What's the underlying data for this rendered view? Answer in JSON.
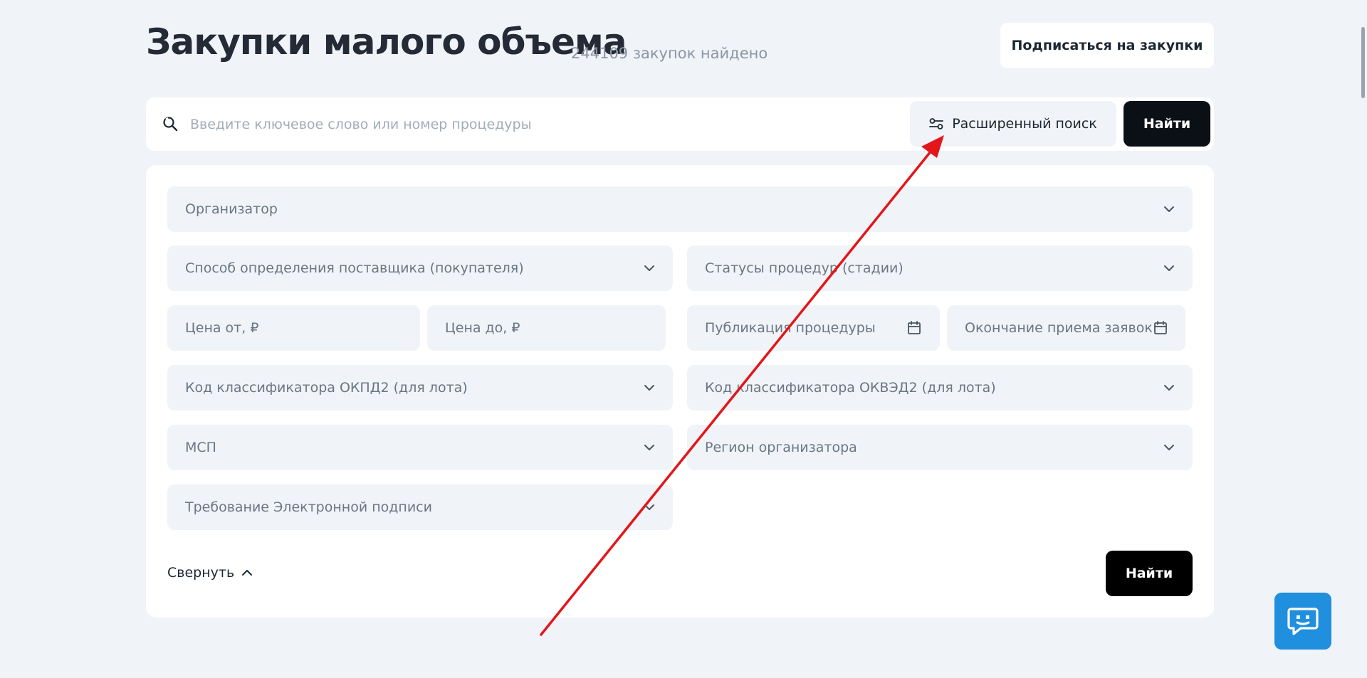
{
  "header": {
    "title": "Закупки малого объема",
    "count": "244109 закупок найдено",
    "subscribe_label": "Подписаться на закупки"
  },
  "search": {
    "placeholder": "Введите ключевое слово или номер процедуры",
    "advanced_label": "Расширенный поиск",
    "find_label": "Найти"
  },
  "filters": {
    "organizer": "Организатор",
    "supplier_method": "Способ определения поставщика (покупателя)",
    "procedure_status": "Статусы процедур (стадии)",
    "price_from": "Цена от, ₽",
    "price_to": "Цена до, ₽",
    "publication": "Публикация процедуры",
    "deadline": "Окончание приема заявок",
    "okpd2": "Код классификатора ОКПД2 (для лота)",
    "okved2": "Код классификатора ОКВЭД2 (для лота)",
    "msp": "МСП",
    "region": "Регион организатора",
    "signature": "Требование Электронной подписи",
    "collapse_label": "Свернуть",
    "find_label": "Найти"
  },
  "colors": {
    "background": "#f0f3f8",
    "primary_button": "#0b1017",
    "chat_widget": "#1f8fde",
    "annotation_arrow": "#e3161a"
  },
  "icons": {
    "search": "search-icon",
    "advanced": "sliders-icon",
    "dropdown": "chevron-down-icon",
    "calendar": "calendar-icon",
    "collapse": "chevron-up-icon",
    "chat": "chat-icon"
  }
}
